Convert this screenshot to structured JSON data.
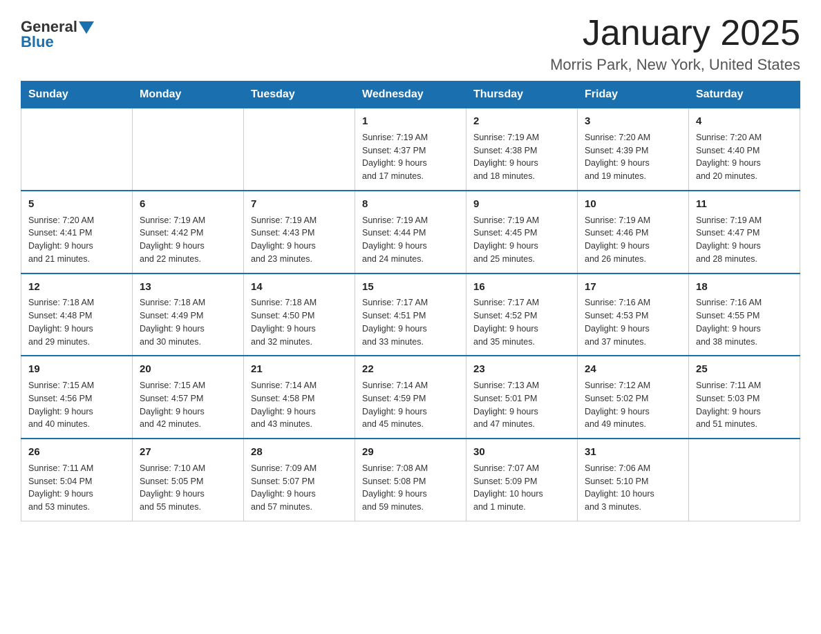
{
  "header": {
    "logo_general": "General",
    "logo_blue": "Blue",
    "title": "January 2025",
    "subtitle": "Morris Park, New York, United States"
  },
  "days_of_week": [
    "Sunday",
    "Monday",
    "Tuesday",
    "Wednesday",
    "Thursday",
    "Friday",
    "Saturday"
  ],
  "weeks": [
    [
      {
        "day": "",
        "info": ""
      },
      {
        "day": "",
        "info": ""
      },
      {
        "day": "",
        "info": ""
      },
      {
        "day": "1",
        "info": "Sunrise: 7:19 AM\nSunset: 4:37 PM\nDaylight: 9 hours\nand 17 minutes."
      },
      {
        "day": "2",
        "info": "Sunrise: 7:19 AM\nSunset: 4:38 PM\nDaylight: 9 hours\nand 18 minutes."
      },
      {
        "day": "3",
        "info": "Sunrise: 7:20 AM\nSunset: 4:39 PM\nDaylight: 9 hours\nand 19 minutes."
      },
      {
        "day": "4",
        "info": "Sunrise: 7:20 AM\nSunset: 4:40 PM\nDaylight: 9 hours\nand 20 minutes."
      }
    ],
    [
      {
        "day": "5",
        "info": "Sunrise: 7:20 AM\nSunset: 4:41 PM\nDaylight: 9 hours\nand 21 minutes."
      },
      {
        "day": "6",
        "info": "Sunrise: 7:19 AM\nSunset: 4:42 PM\nDaylight: 9 hours\nand 22 minutes."
      },
      {
        "day": "7",
        "info": "Sunrise: 7:19 AM\nSunset: 4:43 PM\nDaylight: 9 hours\nand 23 minutes."
      },
      {
        "day": "8",
        "info": "Sunrise: 7:19 AM\nSunset: 4:44 PM\nDaylight: 9 hours\nand 24 minutes."
      },
      {
        "day": "9",
        "info": "Sunrise: 7:19 AM\nSunset: 4:45 PM\nDaylight: 9 hours\nand 25 minutes."
      },
      {
        "day": "10",
        "info": "Sunrise: 7:19 AM\nSunset: 4:46 PM\nDaylight: 9 hours\nand 26 minutes."
      },
      {
        "day": "11",
        "info": "Sunrise: 7:19 AM\nSunset: 4:47 PM\nDaylight: 9 hours\nand 28 minutes."
      }
    ],
    [
      {
        "day": "12",
        "info": "Sunrise: 7:18 AM\nSunset: 4:48 PM\nDaylight: 9 hours\nand 29 minutes."
      },
      {
        "day": "13",
        "info": "Sunrise: 7:18 AM\nSunset: 4:49 PM\nDaylight: 9 hours\nand 30 minutes."
      },
      {
        "day": "14",
        "info": "Sunrise: 7:18 AM\nSunset: 4:50 PM\nDaylight: 9 hours\nand 32 minutes."
      },
      {
        "day": "15",
        "info": "Sunrise: 7:17 AM\nSunset: 4:51 PM\nDaylight: 9 hours\nand 33 minutes."
      },
      {
        "day": "16",
        "info": "Sunrise: 7:17 AM\nSunset: 4:52 PM\nDaylight: 9 hours\nand 35 minutes."
      },
      {
        "day": "17",
        "info": "Sunrise: 7:16 AM\nSunset: 4:53 PM\nDaylight: 9 hours\nand 37 minutes."
      },
      {
        "day": "18",
        "info": "Sunrise: 7:16 AM\nSunset: 4:55 PM\nDaylight: 9 hours\nand 38 minutes."
      }
    ],
    [
      {
        "day": "19",
        "info": "Sunrise: 7:15 AM\nSunset: 4:56 PM\nDaylight: 9 hours\nand 40 minutes."
      },
      {
        "day": "20",
        "info": "Sunrise: 7:15 AM\nSunset: 4:57 PM\nDaylight: 9 hours\nand 42 minutes."
      },
      {
        "day": "21",
        "info": "Sunrise: 7:14 AM\nSunset: 4:58 PM\nDaylight: 9 hours\nand 43 minutes."
      },
      {
        "day": "22",
        "info": "Sunrise: 7:14 AM\nSunset: 4:59 PM\nDaylight: 9 hours\nand 45 minutes."
      },
      {
        "day": "23",
        "info": "Sunrise: 7:13 AM\nSunset: 5:01 PM\nDaylight: 9 hours\nand 47 minutes."
      },
      {
        "day": "24",
        "info": "Sunrise: 7:12 AM\nSunset: 5:02 PM\nDaylight: 9 hours\nand 49 minutes."
      },
      {
        "day": "25",
        "info": "Sunrise: 7:11 AM\nSunset: 5:03 PM\nDaylight: 9 hours\nand 51 minutes."
      }
    ],
    [
      {
        "day": "26",
        "info": "Sunrise: 7:11 AM\nSunset: 5:04 PM\nDaylight: 9 hours\nand 53 minutes."
      },
      {
        "day": "27",
        "info": "Sunrise: 7:10 AM\nSunset: 5:05 PM\nDaylight: 9 hours\nand 55 minutes."
      },
      {
        "day": "28",
        "info": "Sunrise: 7:09 AM\nSunset: 5:07 PM\nDaylight: 9 hours\nand 57 minutes."
      },
      {
        "day": "29",
        "info": "Sunrise: 7:08 AM\nSunset: 5:08 PM\nDaylight: 9 hours\nand 59 minutes."
      },
      {
        "day": "30",
        "info": "Sunrise: 7:07 AM\nSunset: 5:09 PM\nDaylight: 10 hours\nand 1 minute."
      },
      {
        "day": "31",
        "info": "Sunrise: 7:06 AM\nSunset: 5:10 PM\nDaylight: 10 hours\nand 3 minutes."
      },
      {
        "day": "",
        "info": ""
      }
    ]
  ]
}
